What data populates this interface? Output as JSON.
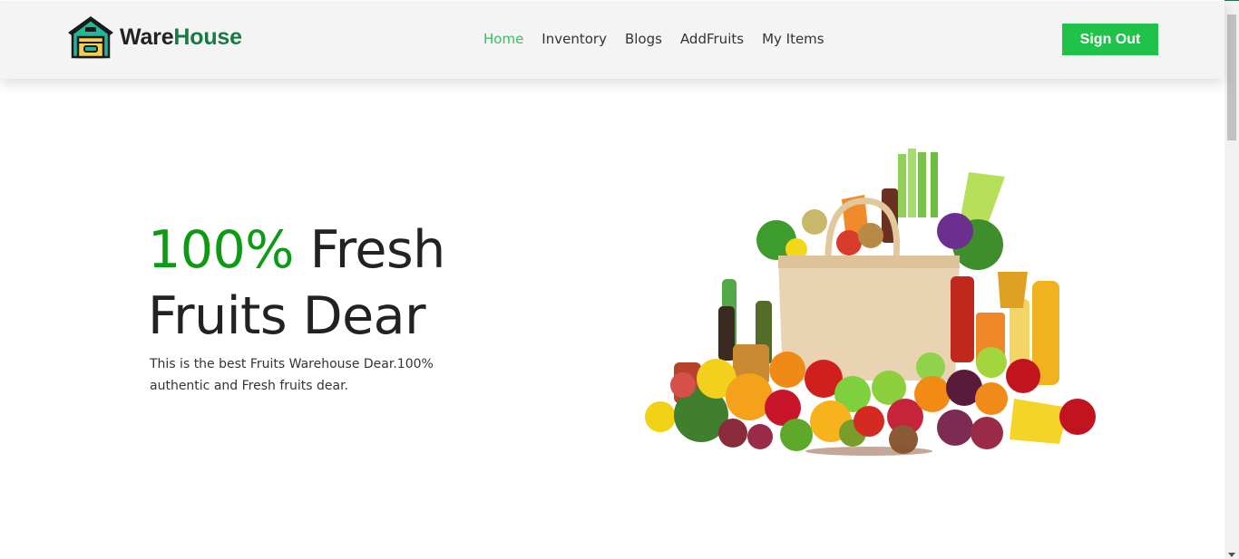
{
  "brand": {
    "part1": "Ware",
    "part2": "House",
    "icon": "warehouse-icon"
  },
  "nav": {
    "items": [
      {
        "label": "Home",
        "active": true
      },
      {
        "label": "Inventory",
        "active": false
      },
      {
        "label": "Blogs",
        "active": false
      },
      {
        "label": "AddFruits",
        "active": false
      },
      {
        "label": "My Items",
        "active": false
      }
    ],
    "signout_label": "Sign Out"
  },
  "hero": {
    "highlight": "100%",
    "title_rest_line1": " Fresh",
    "title_line2": "Fruits Dear",
    "description": "This is the best Fruits Warehouse Dear.100% authentic and Fresh fruits dear.",
    "image": "grocery-bag-fruits-vegetables"
  },
  "colors": {
    "brand_green": "#187a43",
    "accent_green": "#0e9b14",
    "button_green": "#21c24a",
    "active_link": "#32c35a"
  }
}
